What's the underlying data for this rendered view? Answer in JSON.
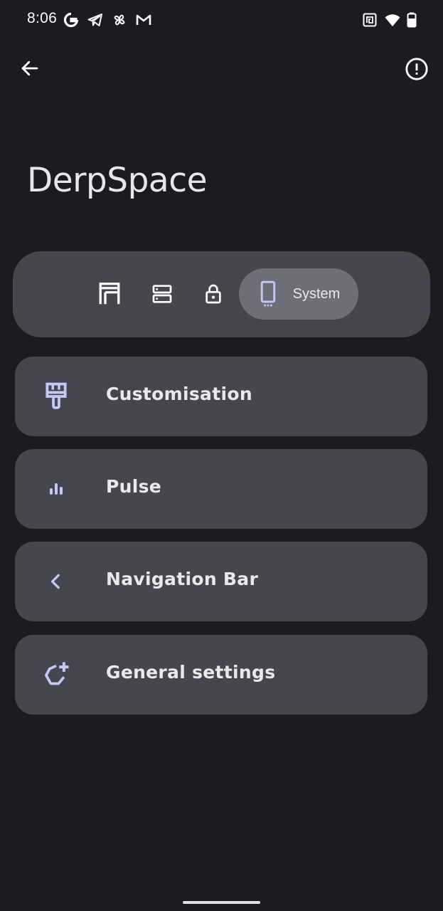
{
  "status_bar": {
    "time": "8:06",
    "notification_icons": [
      "google-icon",
      "telegram-icon",
      "pinwheel-icon",
      "gmail-icon"
    ],
    "system_icons": [
      "nfc-icon",
      "wifi-icon",
      "battery-icon"
    ]
  },
  "app_bar": {
    "back_icon": "arrow-back-icon",
    "info_icon": "info-outline-icon"
  },
  "page": {
    "title": "DerpSpace"
  },
  "tabs": [
    {
      "icon": "statusbar-icon",
      "label": "",
      "active": false
    },
    {
      "icon": "quick-settings-icon",
      "label": "",
      "active": false
    },
    {
      "icon": "lock-icon",
      "label": "",
      "active": false
    },
    {
      "icon": "phone-icon",
      "label": "System",
      "active": true
    }
  ],
  "menu": [
    {
      "label": "Customisation",
      "icon": "paint-brush-icon"
    },
    {
      "label": "Pulse",
      "icon": "equalizer-icon"
    },
    {
      "label": "Navigation Bar",
      "icon": "chevron-left-icon"
    },
    {
      "label": "General settings",
      "icon": "gear-add-icon"
    }
  ],
  "colors": {
    "background": "#1b1c20",
    "surface": "#46474e",
    "active_tab": "#6d6e78",
    "icon_tint": "#c4c8f6",
    "text": "#e9e8ee"
  }
}
